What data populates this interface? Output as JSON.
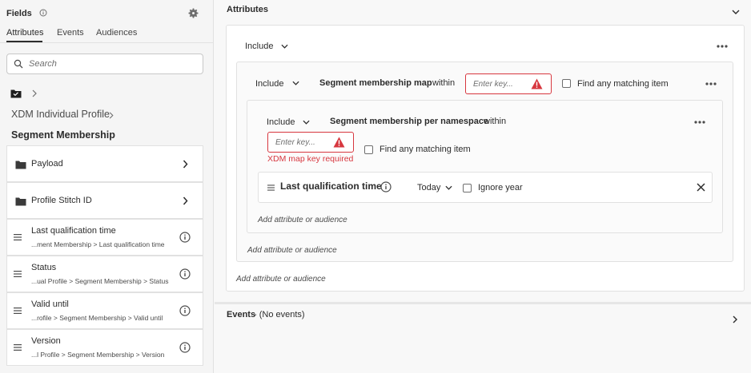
{
  "left_panel": {
    "title": "Fields",
    "tabs": [
      {
        "label": "Attributes",
        "active": true
      },
      {
        "label": "Events",
        "active": false
      },
      {
        "label": "Audiences",
        "active": false
      }
    ],
    "search": {
      "placeholder": "Search",
      "value": ""
    },
    "breadcrumb": {
      "parent": "XDM Individual Profile"
    },
    "current_heading": "Segment Membership",
    "folders": [
      {
        "label": "Payload",
        "icon": "folder-icon"
      },
      {
        "label": "Profile Stitch ID",
        "icon": "folder-icon"
      }
    ],
    "fields": [
      {
        "label": "Last qualification time",
        "path": "...ment Membership > Last qualification time"
      },
      {
        "label": "Status",
        "path": "...ual Profile > Segment Membership > Status"
      },
      {
        "label": "Valid until",
        "path": "...rofile > Segment Membership > Valid until"
      },
      {
        "label": "Version",
        "path": "...l Profile > Segment Membership > Version"
      }
    ]
  },
  "attributes_section": {
    "title": "Attributes",
    "outer_include": "Include",
    "map_row": {
      "include": "Include",
      "field": "Segment membership map",
      "within": "within",
      "key_placeholder": "Enter key...",
      "checkbox_label": "Find any matching item",
      "checked": false
    },
    "namespace_row": {
      "include": "Include",
      "field": "Segment membership per namespace",
      "within": "within",
      "key_placeholder": "Enter key...",
      "error": "XDM map key required",
      "checkbox_label": "Find any matching item",
      "checked": false
    },
    "condition": {
      "field": "Last qualification time",
      "operator": "Today",
      "checkbox_label": "Ignore year",
      "checked": false
    },
    "add_inner": "Add attribute or audience",
    "add_middle": "Add attribute or audience",
    "add_outer": "Add attribute or audience"
  },
  "events_section": {
    "title": "Events",
    "summary": "- (No events)"
  },
  "colors": {
    "error": "#d7373f",
    "text": "#2c2c2c",
    "border": "#e1e1e1"
  }
}
